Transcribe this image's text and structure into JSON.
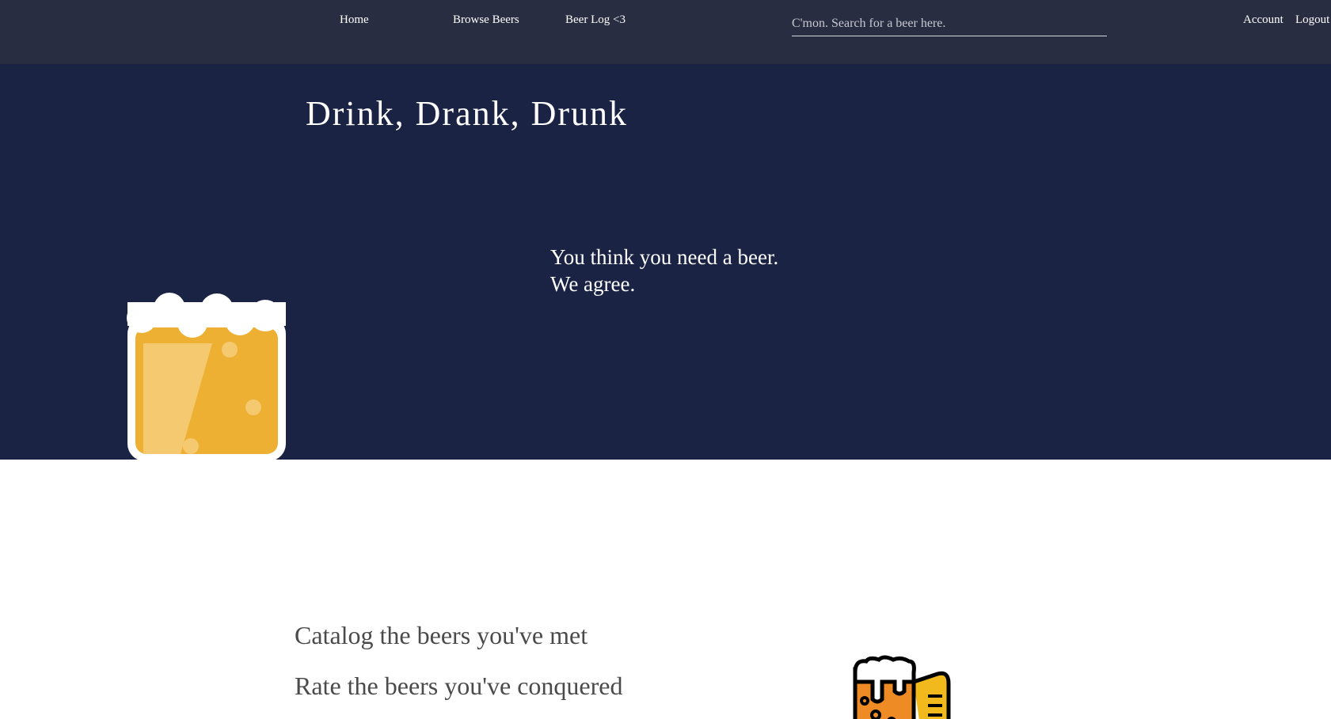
{
  "nav": {
    "home": "Home",
    "browse": "Browse Beers",
    "beer_log": "Beer Log <3",
    "account": "Account",
    "logout": "Logout"
  },
  "search": {
    "placeholder": "C'mon. Search for a beer here.",
    "value": ""
  },
  "hero": {
    "title": "Drink, Drank, Drunk",
    "tagline_line1": "You think you need a beer.",
    "tagline_line2": "We agree."
  },
  "features": {
    "catalog": "Catalog the beers you've met",
    "rate": "Rate the beers you've conquered"
  },
  "icons": {
    "hero_mug": "beer-mug-icon",
    "feature_mug": "beer-mug-icon"
  },
  "colors": {
    "nav_bg": "#292d41",
    "hero_bg": "#1a2343",
    "beer": "#edb033",
    "beer_highlight": "#f4c96f",
    "foam": "#ffffff",
    "feature_text": "#4a4a4a"
  }
}
